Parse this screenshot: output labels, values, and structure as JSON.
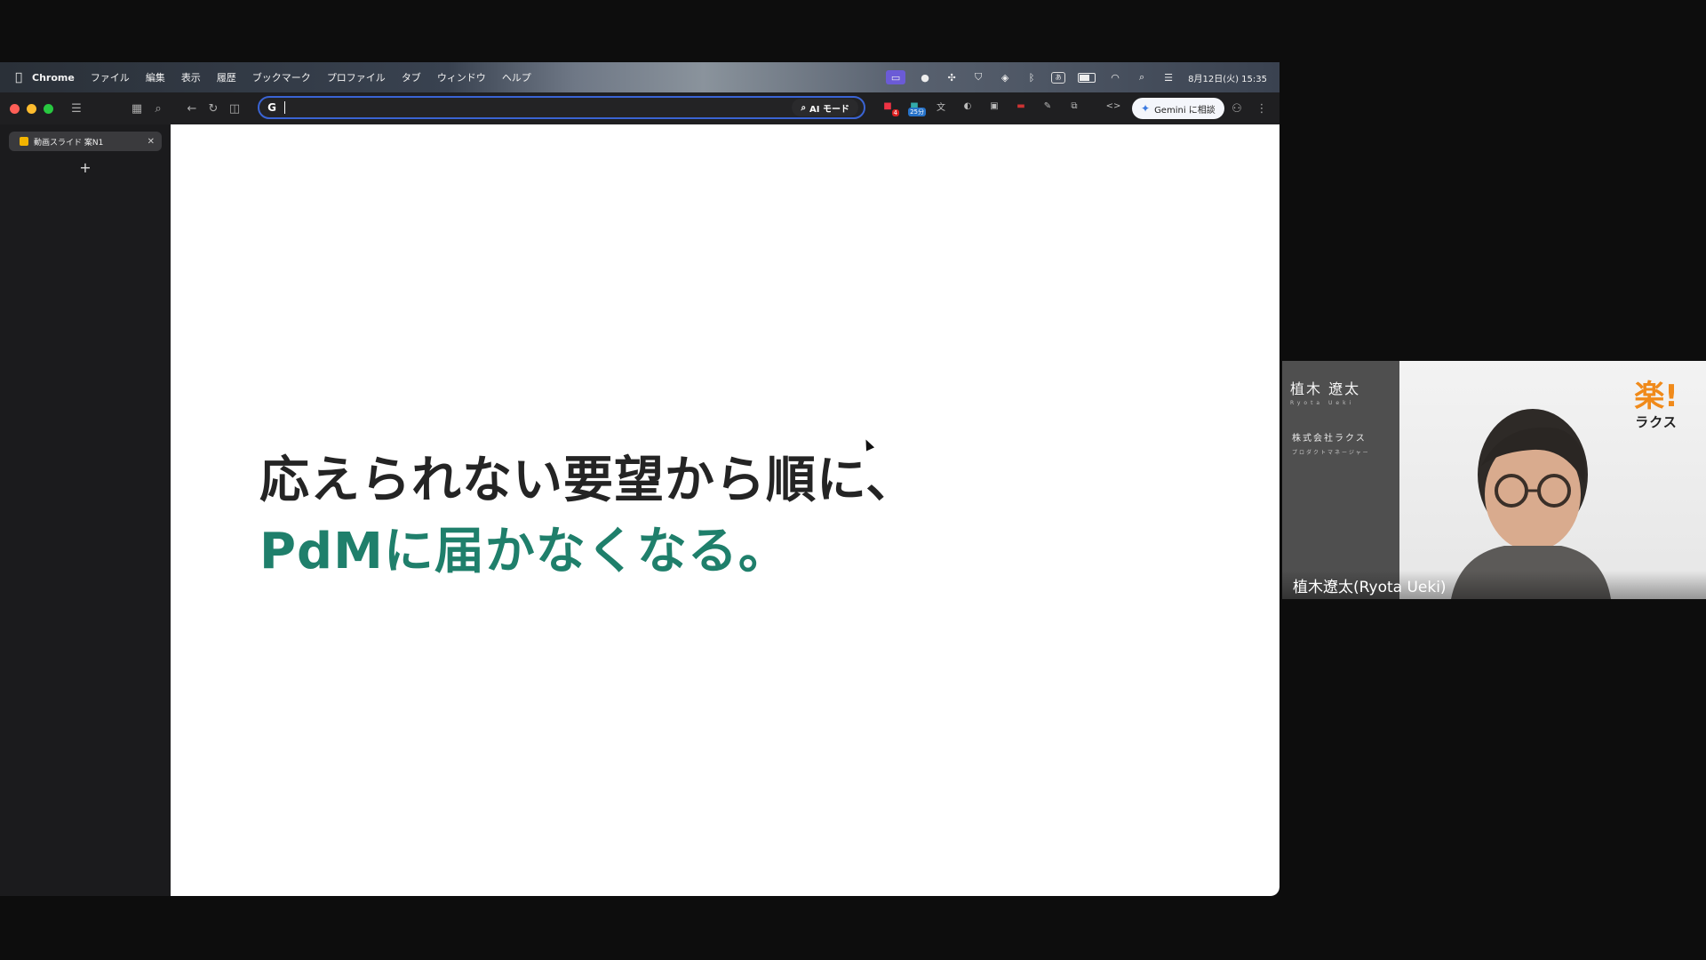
{
  "menubar": {
    "app_name": "Chrome",
    "items": [
      "ファイル",
      "編集",
      "表示",
      "履歴",
      "ブックマーク",
      "プロファイル",
      "タブ",
      "ウィンドウ",
      "ヘルプ"
    ],
    "datetime": "8月12日(火) 15:35"
  },
  "toolbar": {
    "omnibox_value": "",
    "ai_mode_label": "AI モード",
    "gemini_label": "Gemini に相談",
    "ext_badges": [
      "4",
      "25分"
    ]
  },
  "tabs": [
    {
      "label": "動画スライド 案N1"
    }
  ],
  "slide": {
    "line1": "応えられない要望から順に、",
    "line2": "PdMに届かなくなる。",
    "line2_color": "#1f7f6b"
  },
  "participant": {
    "card_name": "植木 遼太",
    "card_romaji": "Ryota Ueki",
    "card_company": "株式会社ラクス",
    "card_role": "プロダクトマネージャー",
    "logo_kanji": "楽!",
    "logo_kana": "ラクス",
    "display_name": "植木遼太(Ryota Ueki)"
  },
  "colors": {
    "omnibox_focus": "#3a64d4",
    "ai_mode_bg": "#2a2a2c",
    "traffic_red": "#ff5f57",
    "traffic_yellow": "#febc2e",
    "traffic_green": "#28c840",
    "logo_orange": "#f08a1a"
  }
}
